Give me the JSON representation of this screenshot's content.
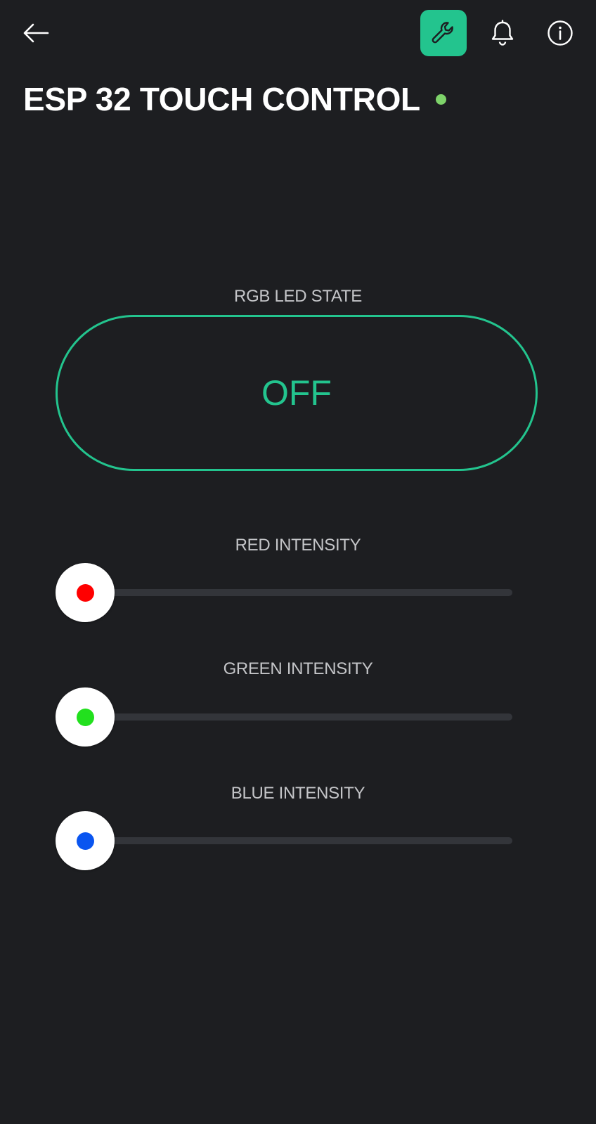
{
  "header": {
    "back_icon": "arrow-left-icon",
    "wrench_icon": "wrench-icon",
    "bell_icon": "bell-icon",
    "info_icon": "info-icon",
    "title": "ESP 32 TOUCH CONTROL",
    "online": true
  },
  "rgb_state": {
    "label": "RGB LED STATE",
    "value": "OFF"
  },
  "sliders": [
    {
      "label": "RED INTENSITY",
      "value_percent": 0,
      "color": "#ff0000"
    },
    {
      "label": "GREEN INTENSITY",
      "value_percent": 0,
      "color": "#22e01e"
    },
    {
      "label": "BLUE INTENSITY",
      "value_percent": 0,
      "color": "#0a55f0"
    }
  ],
  "colors": {
    "background": "#1d1e21",
    "accent": "#23c48e",
    "status_online": "#7ed36a"
  }
}
